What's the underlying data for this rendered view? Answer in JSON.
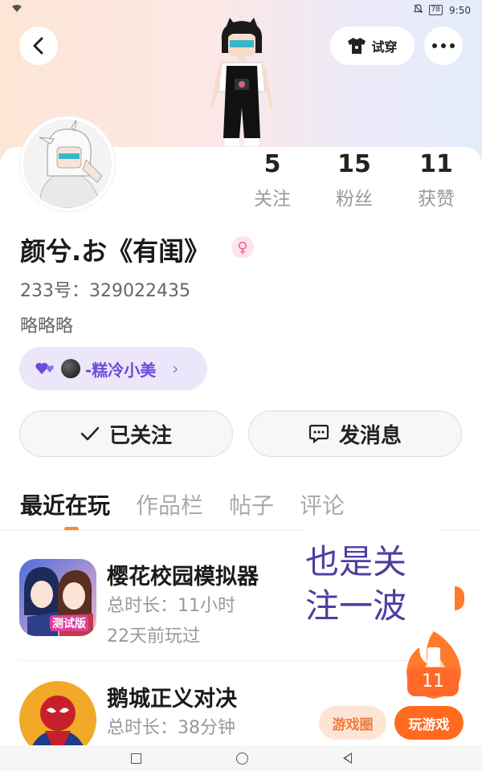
{
  "status_bar": {
    "time": "9:50",
    "battery": "78"
  },
  "header": {
    "tryon_label": "试穿"
  },
  "stats": [
    {
      "value": "5",
      "label": "关注"
    },
    {
      "value": "15",
      "label": "粉丝"
    },
    {
      "value": "11",
      "label": "获赞"
    }
  ],
  "profile": {
    "name": "颜兮.お《有闺》",
    "gender_symbol": "♀",
    "uid": "233号：329022435",
    "bio": "略略略",
    "fan_tag": "-糕冷小美"
  },
  "buttons": {
    "follow": "已关注",
    "message": "发消息"
  },
  "tabs": [
    {
      "label": "最近在玩",
      "active": true
    },
    {
      "label": "作品栏",
      "active": false
    },
    {
      "label": "帖子",
      "active": false
    },
    {
      "label": "评论",
      "active": false
    }
  ],
  "games": [
    {
      "name": "樱花校园模拟器",
      "duration": "总时长：11小时",
      "last_played": "22天前玩过",
      "icon": "sakura-school-icon",
      "badge": "测试版"
    },
    {
      "name": "鹅城正义对决",
      "duration": "总时长：38分钟",
      "icon": "spider-hero-icon"
    }
  ],
  "overlay_note": {
    "line1": "也是关",
    "line2": "注一波"
  },
  "fire_count": "11",
  "game_actions": {
    "circle": "游戏圈",
    "play": "玩游戏"
  },
  "colors": {
    "accent": "#ff6a1f",
    "purple": "#6c4ad8",
    "note": "#4b3fa0"
  }
}
